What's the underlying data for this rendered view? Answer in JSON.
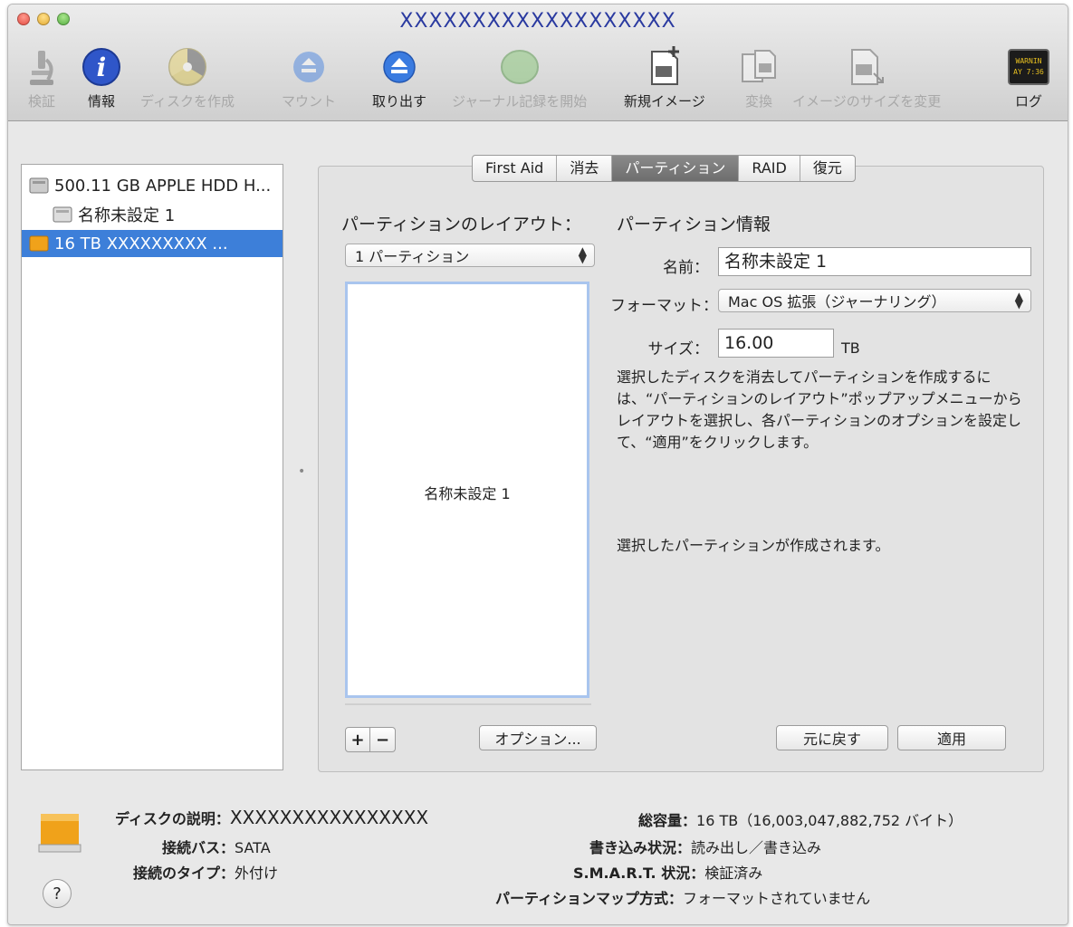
{
  "window": {
    "title": "XXXXXXXXXXXXXXXXXXX"
  },
  "toolbar": {
    "items": [
      {
        "id": "verify",
        "label": "検証",
        "icon": "microscope-icon",
        "enabled": false
      },
      {
        "id": "info",
        "label": "情報",
        "icon": "info-icon",
        "enabled": true
      },
      {
        "id": "burn",
        "label": "ディスクを作成",
        "icon": "burn-disc-icon",
        "enabled": false
      },
      {
        "id": "mount",
        "label": "マウント",
        "icon": "mount-icon",
        "enabled": false
      },
      {
        "id": "eject",
        "label": "取り出す",
        "icon": "eject-icon",
        "enabled": true
      },
      {
        "id": "journal",
        "label": "ジャーナル記録を開始",
        "icon": "journal-icon",
        "enabled": false
      },
      {
        "id": "newimage",
        "label": "新規イメージ",
        "icon": "new-image-icon",
        "enabled": true
      },
      {
        "id": "convert",
        "label": "変換",
        "icon": "convert-icon",
        "enabled": false
      },
      {
        "id": "resize",
        "label": "イメージのサイズを変更",
        "icon": "resize-image-icon",
        "enabled": false
      },
      {
        "id": "log",
        "label": "ログ",
        "icon": "log-icon",
        "enabled": true
      }
    ],
    "log_icon_text": [
      "WARNIN",
      "AY 7:36"
    ]
  },
  "sidebar": {
    "items": [
      {
        "label": "500.11 GB APPLE HDD H...",
        "icon": "hdd-icon",
        "level": 0,
        "selected": false
      },
      {
        "label": "名称未設定 1",
        "icon": "volume-icon",
        "level": 1,
        "selected": false
      },
      {
        "label": "16 TB XXXXXXXXX ...",
        "icon": "external-disk-icon",
        "level": 0,
        "selected": true
      }
    ]
  },
  "tabs": [
    {
      "label": "First Aid",
      "active": false
    },
    {
      "label": "消去",
      "active": false
    },
    {
      "label": "パーティション",
      "active": true
    },
    {
      "label": "RAID",
      "active": false
    },
    {
      "label": "復元",
      "active": false
    }
  ],
  "partition": {
    "layout_label": "パーティションのレイアウト：",
    "layout_value": "1 パーティション",
    "map_name": "名称未設定 1",
    "options_button": "オプション...",
    "add_symbol": "+",
    "remove_symbol": "−",
    "info_label": "パーティション情報",
    "name_label": "名前：",
    "name_value": "名称未設定 1",
    "format_label": "フォーマット：",
    "format_value": "Mac OS 拡張（ジャーナリング）",
    "size_label": "サイズ：",
    "size_value": "16.00",
    "size_unit": "TB",
    "description": "選択したディスクを消去してパーティションを作成するには、“パーティションのレイアウト”ポップアップメニューからレイアウトを選択し、各パーティションのオプションを設定して、“適用”をクリックします。",
    "result_text": "選択したパーティションが作成されます。",
    "revert_button": "元に戻す",
    "apply_button": "適用"
  },
  "bottom": {
    "disk_desc_label": "ディスクの説明：",
    "disk_desc_value": "XXXXXXXXXXXXXXXX",
    "bus_label": "接続バス：",
    "bus_value": "SATA",
    "conn_type_label": "接続のタイプ：",
    "conn_type_value": "外付け",
    "capacity_label": "総容量：",
    "capacity_value": "16 TB（16,003,047,882,752 バイト）",
    "write_label": "書き込み状況：",
    "write_value": "読み出し／書き込み",
    "smart_label": "S.M.A.R.T. 状況：",
    "smart_value": "検証済み",
    "map_scheme_label": "パーティションマップ方式：",
    "map_scheme_value": "フォーマットされていません",
    "help_symbol": "?"
  },
  "colors": {
    "selection": "#3d7fd9",
    "title_text": "#2a3aa0",
    "info_blue": "#2f56c9",
    "eject_blue": "#3a7be0",
    "disk_orange": "#f0a21a"
  }
}
